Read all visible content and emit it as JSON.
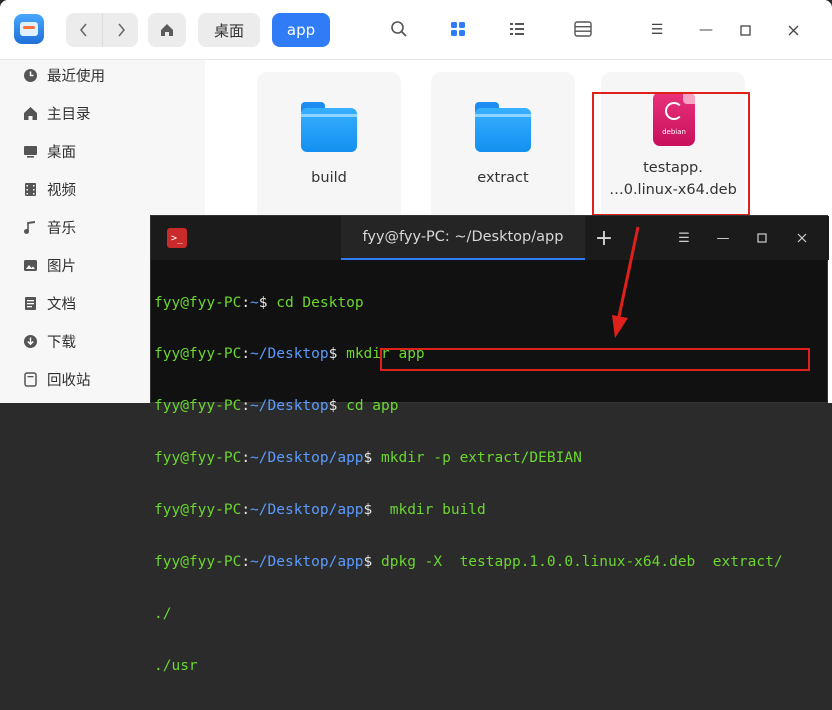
{
  "file_manager": {
    "breadcrumbs": [
      "桌面",
      "app"
    ],
    "sidebar": {
      "items": [
        {
          "label": "最近使用",
          "icon": "clock-icon"
        },
        {
          "label": "主目录",
          "icon": "home-icon"
        },
        {
          "label": "桌面",
          "icon": "desktop-icon"
        },
        {
          "label": "视频",
          "icon": "video-icon"
        },
        {
          "label": "音乐",
          "icon": "music-icon"
        },
        {
          "label": "图片",
          "icon": "picture-icon"
        },
        {
          "label": "文档",
          "icon": "document-icon"
        },
        {
          "label": "下载",
          "icon": "download-icon"
        },
        {
          "label": "回收站",
          "icon": "trash-icon"
        }
      ]
    },
    "files": [
      {
        "name": "build",
        "type": "folder"
      },
      {
        "name": "extract",
        "type": "folder"
      },
      {
        "name_line1": "testapp.",
        "name_line2": "…0.linux-x64.deb",
        "type": "deb",
        "badge": "debian"
      }
    ]
  },
  "terminal": {
    "tab_title": "fyy@fyy-PC: ~/Desktop/app",
    "lines": [
      {
        "user": "fyy@fyy-PC",
        "sep": ":",
        "path": "~",
        "sym": "$",
        "cmd": " cd Desktop"
      },
      {
        "user": "fyy@fyy-PC",
        "sep": ":",
        "path": "~/Desktop",
        "sym": "$",
        "cmd": " mkdir app"
      },
      {
        "user": "fyy@fyy-PC",
        "sep": ":",
        "path": "~/Desktop",
        "sym": "$",
        "cmd": " cd app"
      },
      {
        "user": "fyy@fyy-PC",
        "sep": ":",
        "path": "~/Desktop/app",
        "sym": "$",
        "cmd": " mkdir -p extract/DEBIAN"
      },
      {
        "user": "fyy@fyy-PC",
        "sep": ":",
        "path": "~/Desktop/app",
        "sym": "$",
        "cmd": "  mkdir build"
      },
      {
        "user": "fyy@fyy-PC",
        "sep": ":",
        "path": "~/Desktop/app",
        "sym": "$",
        "cmd": " dpkg -X  testapp.1.0.0.linux-x64.deb  extract/"
      }
    ],
    "output": [
      "./",
      "./usr"
    ]
  },
  "colors": {
    "accent": "#2f7cf6",
    "highlight": "#e0201a",
    "terminal_green": "#6bd72f"
  }
}
